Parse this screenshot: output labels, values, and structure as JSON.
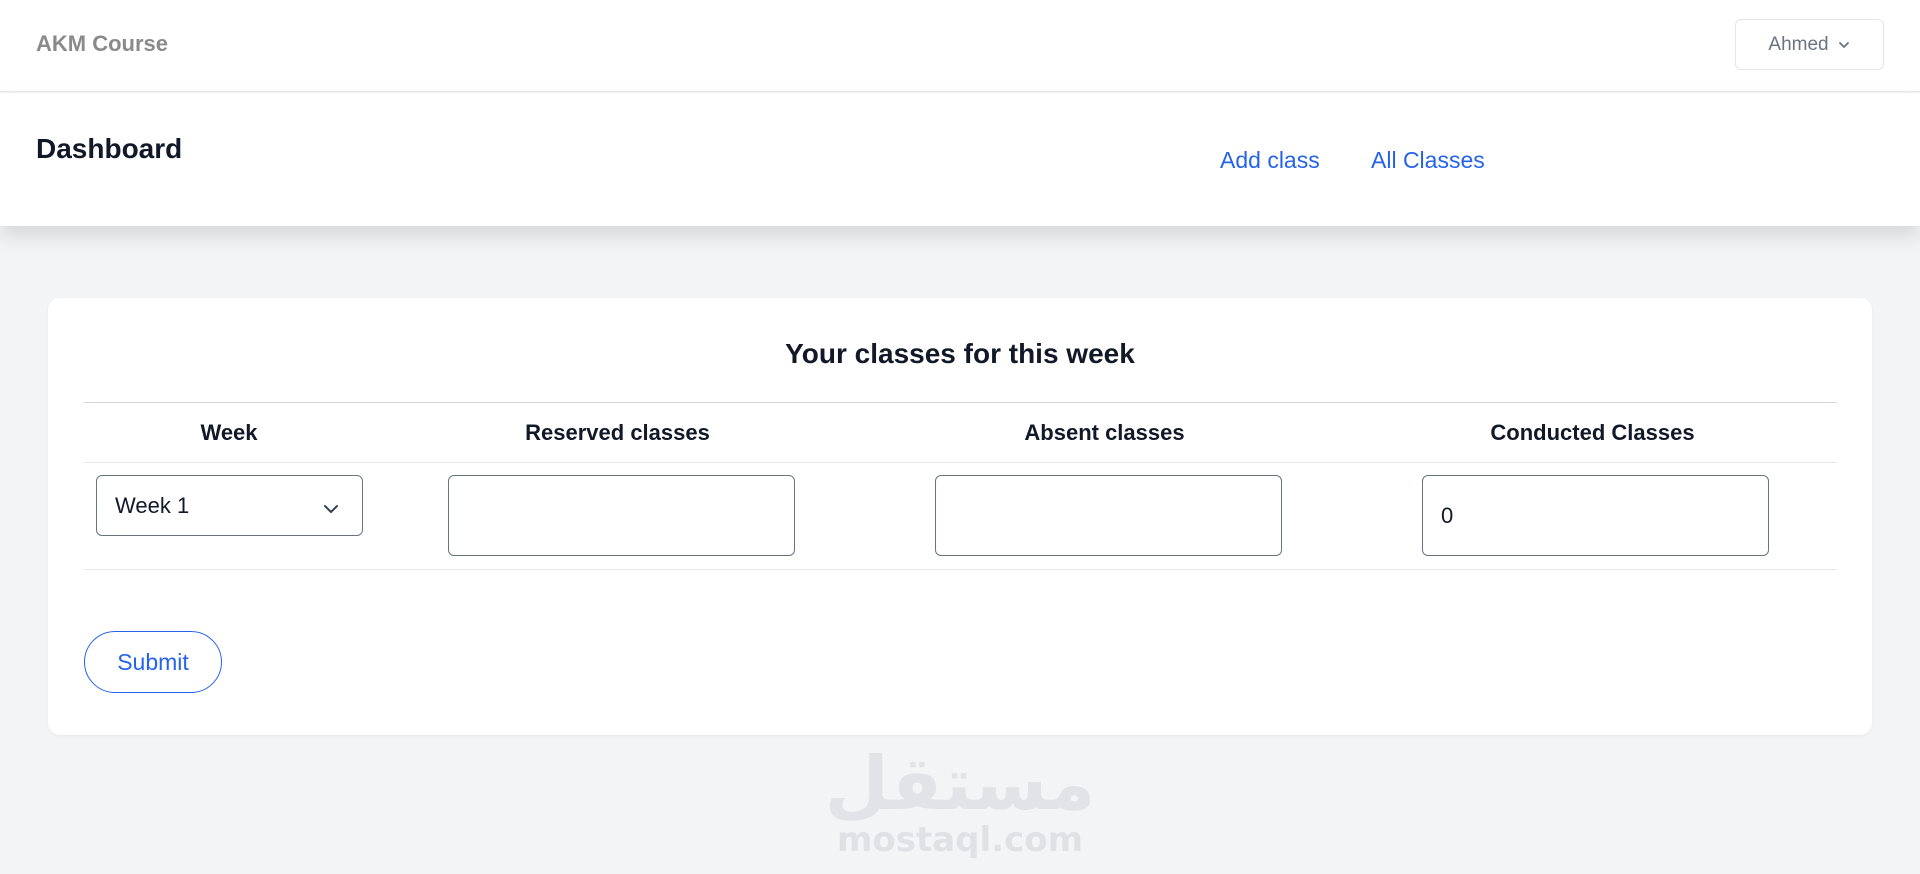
{
  "topbar": {
    "brand": "AKM Course",
    "user_name": "Ahmed",
    "user_menu_icon": "chevron-down-icon"
  },
  "header": {
    "title": "Dashboard",
    "links": {
      "add_class": "Add class",
      "all_classes": "All Classes"
    }
  },
  "card": {
    "title": "Your classes for this week",
    "columns": {
      "week": "Week",
      "reserved": "Reserved classes",
      "absent": "Absent classes",
      "conducted": "Conducted Classes"
    },
    "row": {
      "week_selected": "Week 1",
      "reserved_value": "",
      "absent_value": "",
      "conducted_value": "0"
    },
    "submit_label": "Submit"
  },
  "watermark": {
    "arabic": "مستقل",
    "latin": "mostaql.com"
  },
  "colors": {
    "accent": "#2563eb",
    "background": "#f3f4f6",
    "brand_text": "#8a8a8a"
  }
}
